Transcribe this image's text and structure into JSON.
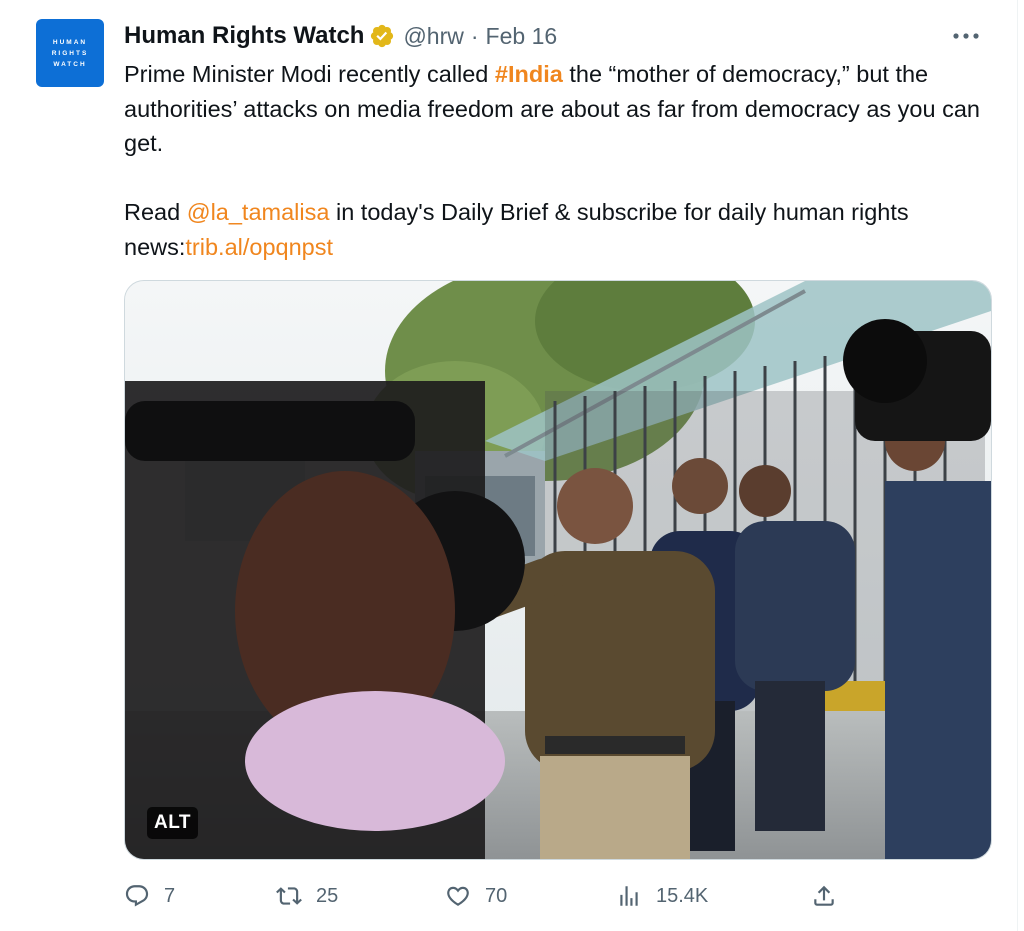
{
  "account": {
    "name": "Human Rights Watch",
    "handle": "@hrw",
    "separator": "·",
    "date": "Feb 16",
    "logo_lines": [
      "HUMAN",
      "RIGHTS",
      "WATCH"
    ]
  },
  "tweet": {
    "p1_pre": "Prime Minister Modi recently called ",
    "hashtag": "#India",
    "p1_post": " the “mother of democracy,” but the authorities’ attacks on media freedom are about as far from democracy as you can get.",
    "p2_pre": "Read ",
    "mention": "@la_tamalisa",
    "p2_mid": " in today's Daily Brief & subscribe for daily human rights news:",
    "link": "trib.al/opqnpst"
  },
  "media": {
    "alt_label": "ALT"
  },
  "actions": {
    "replies": "7",
    "retweets": "25",
    "likes": "70",
    "views": "15.4K"
  },
  "colors": {
    "accent": "#f0861e",
    "logo_bg": "#0d6fd6",
    "muted": "#536471",
    "verified": "#e2b719"
  },
  "icons": [
    "more-icon",
    "verified-badge-icon",
    "reply-icon",
    "retweet-icon",
    "like-icon",
    "views-icon",
    "share-icon"
  ]
}
